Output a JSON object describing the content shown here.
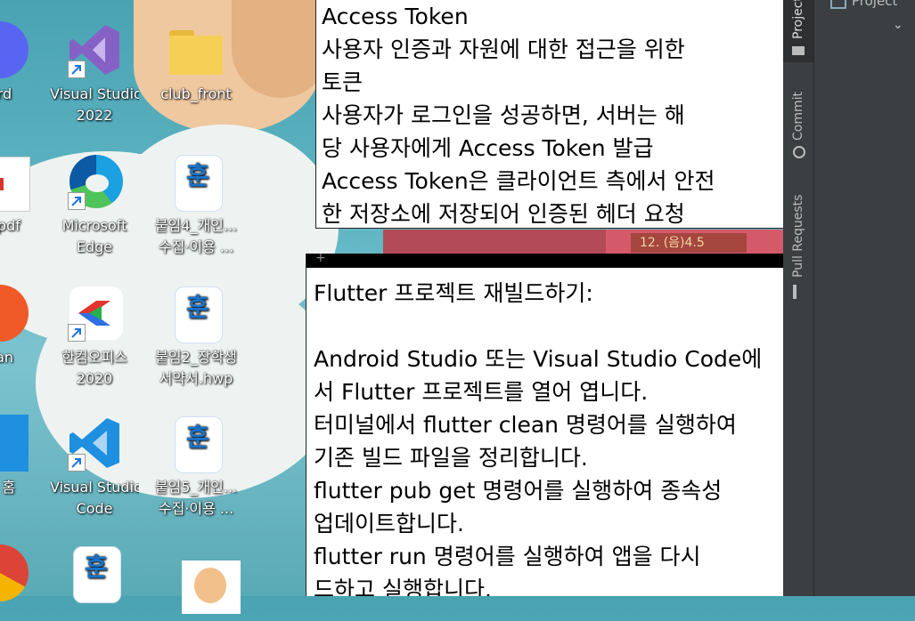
{
  "desktop": {
    "icons": [
      {
        "label": "ord",
        "label2": "",
        "icon": "discord-icon"
      },
      {
        "label": "Visual Studio",
        "label2": "2022",
        "icon": "visual-studio-icon"
      },
      {
        "label": "club_front",
        "label2": "",
        "icon": "folder-icon"
      },
      {
        "label": "불.pdf",
        "label2": "",
        "icon": "pdf-icon"
      },
      {
        "label": "Microsoft",
        "label2": "Edge",
        "icon": "edge-icon"
      },
      {
        "label": "붙임4_개인...",
        "label2": "수집·이용 ...",
        "icon": "hwp-icon"
      },
      {
        "label": "nan",
        "label2": "",
        "icon": "app-icon"
      },
      {
        "label": "한컴오피스",
        "label2": "2020",
        "icon": "hancom-icon"
      },
      {
        "label": "붙임2_장학생",
        "label2": "서약서.hwp",
        "icon": "hwp-icon"
      },
      {
        "label": "드 홈",
        "label2": "",
        "icon": "app-icon"
      },
      {
        "label": "Visual Studio",
        "label2": "Code",
        "icon": "vscode-icon"
      },
      {
        "label": "붙임5_개인...",
        "label2": "수집·이용 ...",
        "icon": "hwp-icon"
      }
    ],
    "wallpaper_badge": "12. (음)4.5"
  },
  "note1": {
    "lines": [
      "Access Token",
      "사용자 인증과 자원에 대한 접근을 위한",
      "토큰",
      "사용자가 로그인을 성공하면, 서버는 해",
      "당 사용자에게 Access Token 발급",
      "Access Token은 클라이언트 측에서 안전",
      "한 저장소에 저장되어 인증된 헤더 요청"
    ]
  },
  "note2": {
    "plus": "+",
    "lines": [
      "Flutter 프로젝트 재빌드하기:",
      "",
      "Android Studio 또는 Visual Studio Code에",
      "서 Flutter 프로젝트를 열어 엽니다.",
      "터미널에서 flutter clean 명령어를 실행하여",
      "기존 빌드 파일을 정리합니다.",
      "flutter pub get 명령어를 실행하여 종속성",
      "업데이트합니다.",
      "flutter run 명령어를 실행하여 앱을 다시",
      "드하고 실행합니다."
    ]
  },
  "ide": {
    "tabs": [
      "Project",
      "Commit",
      "Pull Requests"
    ],
    "pane_title": "Project",
    "colors": {
      "panel": "#3c3f41",
      "text": "#bbbbbb"
    }
  }
}
